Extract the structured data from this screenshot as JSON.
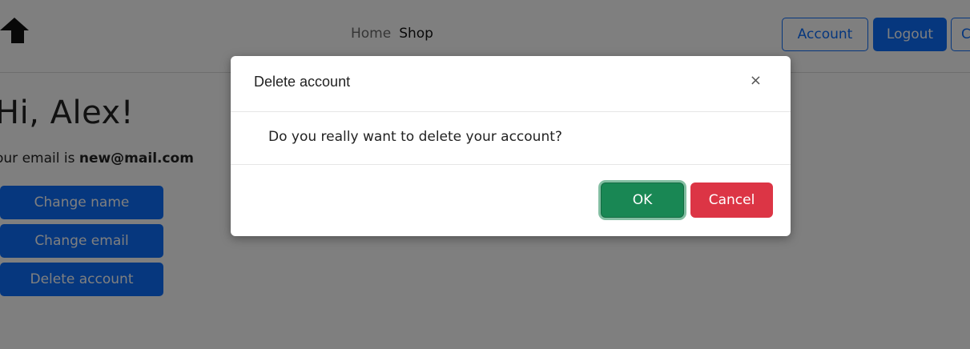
{
  "navbar": {
    "brand_icon": "house-icon",
    "links": [
      "Home",
      "Shop"
    ],
    "account_label": "Account",
    "logout_label": "Logout",
    "partial_label": "C"
  },
  "profile": {
    "greeting": "Hi, Alex!",
    "email_prefix": "our email is ",
    "email": "new@mail.com",
    "buttons": [
      "Change name",
      "Change email",
      "Delete account"
    ]
  },
  "modal": {
    "title": "Delete account",
    "close_label": "×",
    "message": "Do you really want to delete your account?",
    "ok_label": "OK",
    "cancel_label": "Cancel"
  },
  "colors": {
    "primary": "#0d6efd",
    "success": "#198754",
    "danger": "#dc3545"
  }
}
